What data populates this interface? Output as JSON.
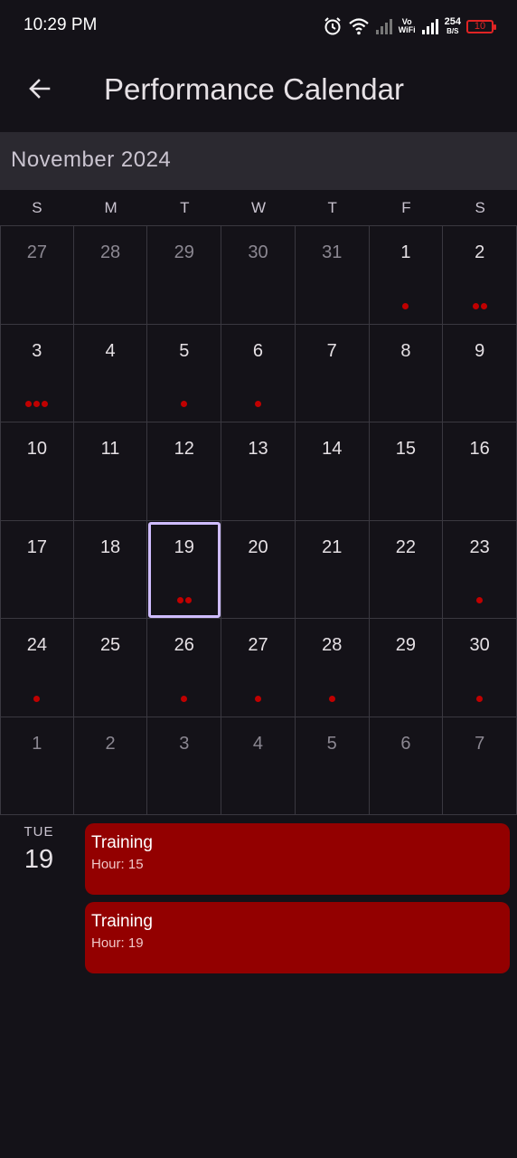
{
  "status_bar": {
    "time": "10:29 PM",
    "vowifi_top": "Vo",
    "vowifi_bottom": "WiFi",
    "speed_value": "254",
    "speed_unit": "B/S",
    "battery": "10"
  },
  "app_bar": {
    "title": "Performance Calendar",
    "back_icon": "arrow-back-icon"
  },
  "calendar": {
    "month_label": "November 2024",
    "weekdays": [
      "S",
      "M",
      "T",
      "W",
      "T",
      "F",
      "S"
    ],
    "days": [
      {
        "label": "27",
        "other": true,
        "dots": 0
      },
      {
        "label": "28",
        "other": true,
        "dots": 0
      },
      {
        "label": "29",
        "other": true,
        "dots": 0
      },
      {
        "label": "30",
        "other": true,
        "dots": 0
      },
      {
        "label": "31",
        "other": true,
        "dots": 0
      },
      {
        "label": "1",
        "other": false,
        "dots": 1
      },
      {
        "label": "2",
        "other": false,
        "dots": 2
      },
      {
        "label": "3",
        "other": false,
        "dots": 3
      },
      {
        "label": "4",
        "other": false,
        "dots": 0
      },
      {
        "label": "5",
        "other": false,
        "dots": 1
      },
      {
        "label": "6",
        "other": false,
        "dots": 1
      },
      {
        "label": "7",
        "other": false,
        "dots": 0
      },
      {
        "label": "8",
        "other": false,
        "dots": 0
      },
      {
        "label": "9",
        "other": false,
        "dots": 0
      },
      {
        "label": "10",
        "other": false,
        "dots": 0
      },
      {
        "label": "11",
        "other": false,
        "dots": 0
      },
      {
        "label": "12",
        "other": false,
        "dots": 0
      },
      {
        "label": "13",
        "other": false,
        "dots": 0
      },
      {
        "label": "14",
        "other": false,
        "dots": 0
      },
      {
        "label": "15",
        "other": false,
        "dots": 0
      },
      {
        "label": "16",
        "other": false,
        "dots": 0
      },
      {
        "label": "17",
        "other": false,
        "dots": 0
      },
      {
        "label": "18",
        "other": false,
        "dots": 0
      },
      {
        "label": "19",
        "other": false,
        "dots": 2,
        "selected": true
      },
      {
        "label": "20",
        "other": false,
        "dots": 0
      },
      {
        "label": "21",
        "other": false,
        "dots": 0
      },
      {
        "label": "22",
        "other": false,
        "dots": 0
      },
      {
        "label": "23",
        "other": false,
        "dots": 1
      },
      {
        "label": "24",
        "other": false,
        "dots": 1
      },
      {
        "label": "25",
        "other": false,
        "dots": 0
      },
      {
        "label": "26",
        "other": false,
        "dots": 1
      },
      {
        "label": "27",
        "other": false,
        "dots": 1
      },
      {
        "label": "28",
        "other": false,
        "dots": 1
      },
      {
        "label": "29",
        "other": false,
        "dots": 0
      },
      {
        "label": "30",
        "other": false,
        "dots": 1
      },
      {
        "label": "1",
        "other": true,
        "dots": 0
      },
      {
        "label": "2",
        "other": true,
        "dots": 0
      },
      {
        "label": "3",
        "other": true,
        "dots": 0
      },
      {
        "label": "4",
        "other": true,
        "dots": 0
      },
      {
        "label": "5",
        "other": true,
        "dots": 0
      },
      {
        "label": "6",
        "other": true,
        "dots": 0
      },
      {
        "label": "7",
        "other": true,
        "dots": 0
      }
    ]
  },
  "selected_day": {
    "weekday": "TUE",
    "day": "19",
    "events": [
      {
        "title": "Training",
        "subtitle": "Hour: 15"
      },
      {
        "title": "Training",
        "subtitle": "Hour: 19"
      }
    ]
  },
  "colors": {
    "background": "#141218",
    "event_card": "#930000",
    "event_dot": "#c00000",
    "selection_border": "#cfbcff"
  }
}
